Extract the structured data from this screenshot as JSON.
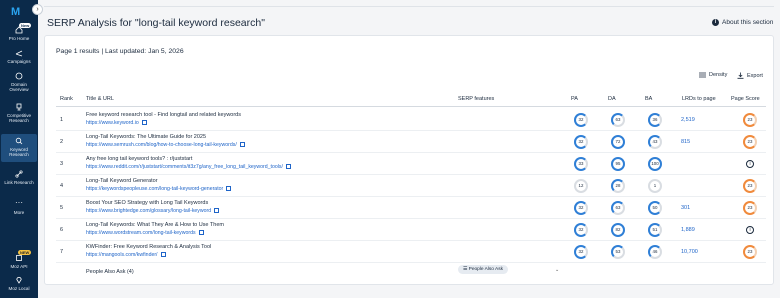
{
  "sidebar": {
    "logo": "M",
    "collapse": "›",
    "new_badge": "New",
    "items": [
      {
        "label": "Pro Home"
      },
      {
        "label": "Campaigns"
      },
      {
        "label": "Domain Overview"
      },
      {
        "label": "Competitive Research"
      },
      {
        "label": "Keyword Research"
      },
      {
        "label": "Link Research"
      },
      {
        "label": "More"
      },
      {
        "label": "Moz API"
      },
      {
        "label": "Moz Local"
      }
    ],
    "api_badge": "NEW"
  },
  "page": {
    "title": "SERP Analysis for \"long-tail keyword research\"",
    "about": "About this section"
  },
  "card": {
    "results_line": "Page 1 results | Last updated: Jan 5, 2026",
    "density": "Density",
    "export": "Export"
  },
  "table": {
    "headers": [
      "Rank",
      "Title & URL",
      "SERP features",
      "PA",
      "DA",
      "BA",
      "LRDs to page",
      "Page Score"
    ],
    "rows": [
      {
        "rank": "1",
        "title": "Free keyword research tool - Find longtail and related keywords",
        "url": "https://www.keyword.io",
        "pa": "32",
        "da": "63",
        "ba": "36",
        "lrd": "2,519",
        "score": "23"
      },
      {
        "rank": "2",
        "title": "Long-Tail Keywords: The Ultimate Guide for 2025",
        "url": "https://www.semrush.com/blog/how-to-choose-long-tail-keywords/",
        "pa": "32",
        "da": "72",
        "ba": "43",
        "lrd": "815",
        "score": "23"
      },
      {
        "rank": "3",
        "title": "Any free long tail keyword tools? : r/juststart",
        "url": "https://www.reddit.com/r/juststart/comments/it3z7g/any_free_long_tail_keyword_tools/",
        "pa": "33",
        "da": "95",
        "ba": "100",
        "lrd": "",
        "score": ""
      },
      {
        "rank": "4",
        "title": "Long-Tail Keyword Generator",
        "url": "https://keywordspeopleuse.com/long-tail-keyword-generator",
        "pa": "12",
        "da": "28",
        "ba": "1",
        "lrd": "",
        "score": "23"
      },
      {
        "rank": "5",
        "title": "Boost Your SEO Strategy with Long Tail Keywords",
        "url": "https://www.brightedge.com/glossary/long-tail-keyword",
        "pa": "32",
        "da": "63",
        "ba": "50",
        "lrd": "301",
        "score": "23"
      },
      {
        "rank": "6",
        "title": "Long-Tail Keywords: What They Are & How to Use Them",
        "url": "https://www.wordstream.com/long-tail-keywords",
        "pa": "32",
        "da": "82",
        "ba": "51",
        "lrd": "1,889",
        "score": ""
      },
      {
        "rank": "7",
        "title": "KWFinder: Free Keyword Research & Analysis Tool",
        "url": "https://mangools.com/kwfinder/",
        "pa": "32",
        "da": "53",
        "ba": "46",
        "lrd": "10,700",
        "score": "23"
      }
    ],
    "paa_label": "People Also Ask (4)",
    "paa_pill": "People Also Ask",
    "paa_chevron": "⌄"
  }
}
